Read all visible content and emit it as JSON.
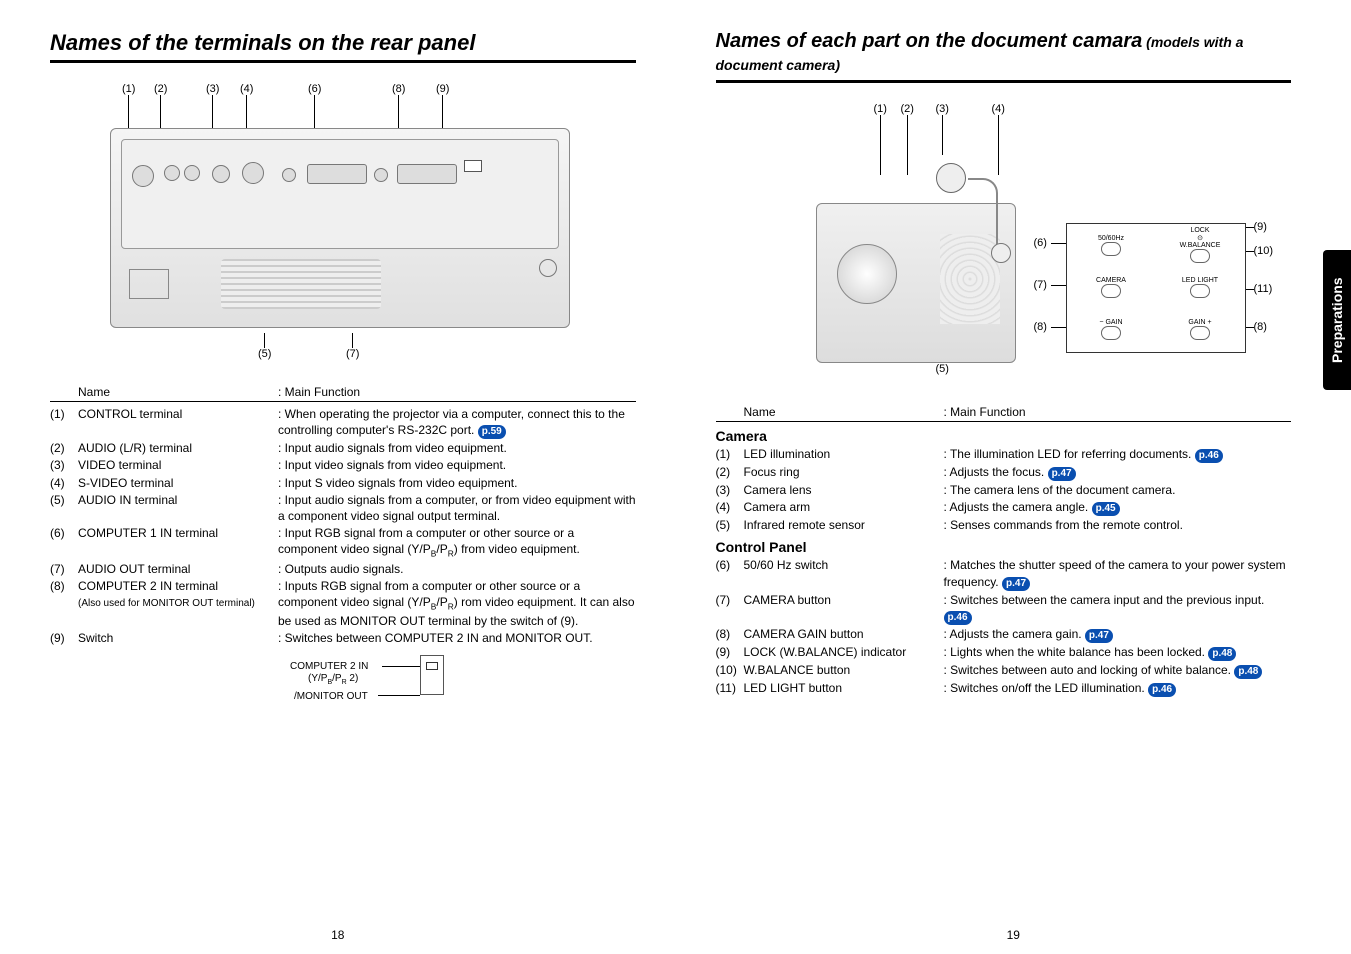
{
  "left": {
    "title": "Names of the terminals on the rear panel",
    "callouts_top": [
      "(1)",
      "(2)",
      "(3)",
      "(4)",
      "(6)",
      "(8)",
      "(9)"
    ],
    "callouts_bottom": [
      "(5)",
      "(7)"
    ],
    "header_name": "Name",
    "header_func": ": Main Function",
    "rows": [
      {
        "n": "(1)",
        "name": "CONTROL terminal",
        "func": ": When operating the projector via a computer, connect this to the controlling computer's RS-232C port.",
        "pref": "p.59"
      },
      {
        "n": "(2)",
        "name": "AUDIO (L/R) terminal",
        "func": ": Input audio signals from video equipment."
      },
      {
        "n": "(3)",
        "name": "VIDEO  terminal",
        "func": ": Input video signals from video equipment."
      },
      {
        "n": "(4)",
        "name": "S-VIDEO terminal",
        "func": ": Input S video signals from video equipment."
      },
      {
        "n": "(5)",
        "name": "AUDIO IN terminal",
        "func": ": Input audio signals from a computer, or from video equipment with a component video signal output terminal."
      },
      {
        "n": "(6)",
        "name": "COMPUTER 1 IN terminal",
        "func": ": Input RGB signal from a computer or other source or a component video signal (Y/PB/PR) from video equipment."
      },
      {
        "n": "(7)",
        "name": "AUDIO OUT terminal",
        "func": ": Outputs audio signals."
      },
      {
        "n": "(8)",
        "name": "COMPUTER 2 IN terminal",
        "sub": "(Also used for MONITOR OUT terminal)",
        "func": ": Inputs RGB signal from a computer or other source or a component video signal (Y/PB/PR) rom video equipment. It can also be used as MONITOR OUT terminal by the switch of (9)."
      },
      {
        "n": "(9)",
        "name": "Switch",
        "func": ": Switches between COMPUTER 2 IN and MONITOR OUT."
      }
    ],
    "switch_labels": {
      "a": "COMPUTER 2 IN",
      "b": "(Y/PB/PR 2)",
      "c": "/MONITOR OUT"
    },
    "page_num": "18"
  },
  "right": {
    "title_main": "Names of each part on the document camara",
    "title_sub": " (models with a document camera)",
    "callouts_top": [
      "(1)",
      "(2)",
      "(3)",
      "(4)"
    ],
    "callout_bottom": "(5)",
    "panel_callouts": {
      "l6": "(6)",
      "l7": "(7)",
      "l8": "(8)",
      "r9": "(9)",
      "r10": "(10)",
      "r11": "(11)",
      "r8": "(8)"
    },
    "panel_labels": {
      "lock": "LOCK",
      "wbal": "W.BALANCE",
      "hz": "50/60Hz",
      "camera": "CAMERA",
      "led": "LED LIGHT",
      "gainm": "−",
      "gain": "GAIN",
      "gainp": "+"
    },
    "header_name": "Name",
    "header_func": ": Main Function",
    "section_camera": "Camera",
    "camera_rows": [
      {
        "n": "(1)",
        "name": "LED illumination",
        "func": ": The illumination LED for referring documents.",
        "pref": "p.46"
      },
      {
        "n": "(2)",
        "name": "Focus ring",
        "func": ": Adjusts the focus.",
        "pref": "p.47"
      },
      {
        "n": "(3)",
        "name": "Camera lens",
        "func": ": The camera lens of the document camera."
      },
      {
        "n": "(4)",
        "name": "Camera arm",
        "func": ": Adjusts the camera angle.",
        "pref": "p.45"
      },
      {
        "n": "(5)",
        "name": "Infrared remote sensor",
        "func": ": Senses commands from the remote control."
      }
    ],
    "section_control": "Control Panel",
    "control_rows": [
      {
        "n": "(6)",
        "name": "50/60 Hz switch",
        "func": ": Matches the shutter speed of the camera to your power system frequency.",
        "pref": "p.47"
      },
      {
        "n": "(7)",
        "name": "CAMERA button",
        "func": ": Switches between the camera input and the previous input.",
        "pref": "p.46"
      },
      {
        "n": "(8)",
        "name": "CAMERA GAIN button",
        "func": ": Adjusts the camera gain.",
        "pref": "p.47"
      },
      {
        "n": "(9)",
        "name": "LOCK (W.BALANCE) indicator",
        "func": ": Lights when the white balance has been locked.",
        "pref": "p.48"
      },
      {
        "n": "(10)",
        "name": "W.BALANCE button",
        "func": ": Switches between auto and locking of white balance.",
        "pref": "p.48"
      },
      {
        "n": "(11)",
        "name": "LED LIGHT button",
        "func": ": Switches on/off the LED illumination.",
        "pref": "p.46"
      }
    ],
    "side_tab": "Preparations",
    "page_num": "19"
  }
}
